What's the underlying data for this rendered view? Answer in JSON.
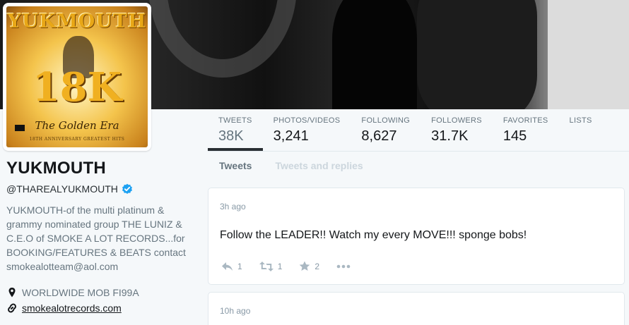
{
  "avatar": {
    "title": "YUKMOUTH",
    "big": "18K",
    "subtitle": "The Golden Era",
    "tagline": "18TH ANNIVERSARY GREATEST HITS"
  },
  "profile": {
    "name": "YUKMOUTH",
    "handle": "@THAREALYUKMOUTH",
    "bio": "YUKMOUTH-of the multi platinum & grammy nominated group THE LUNIZ & C.E.O of SMOKE A LOT RECORDS...for BOOKING/FEATURES & BEATS contact smokealotteam@aol.com",
    "location": "WORLDWIDE MOB FI99A",
    "website": "smokealotrecords.com"
  },
  "nav": [
    {
      "label": "TWEETS",
      "value": "38K"
    },
    {
      "label": "PHOTOS/VIDEOS",
      "value": "3,241"
    },
    {
      "label": "FOLLOWING",
      "value": "8,627"
    },
    {
      "label": "FOLLOWERS",
      "value": "31.7K"
    },
    {
      "label": "FAVORITES",
      "value": "145"
    },
    {
      "label": "LISTS",
      "value": ""
    }
  ],
  "subtabs": {
    "tweets": "Tweets",
    "replies": "Tweets and replies"
  },
  "tweets": [
    {
      "time": "3h ago",
      "text": "Follow the LEADER!! Watch my every MOVE!!! sponge bobs!",
      "replies": "1",
      "retweets": "1",
      "favorites": "2"
    },
    {
      "time": "10h ago"
    }
  ],
  "colors": {
    "accent": "#292f33",
    "verified": "#1da1f2",
    "muted": "#66757f"
  }
}
